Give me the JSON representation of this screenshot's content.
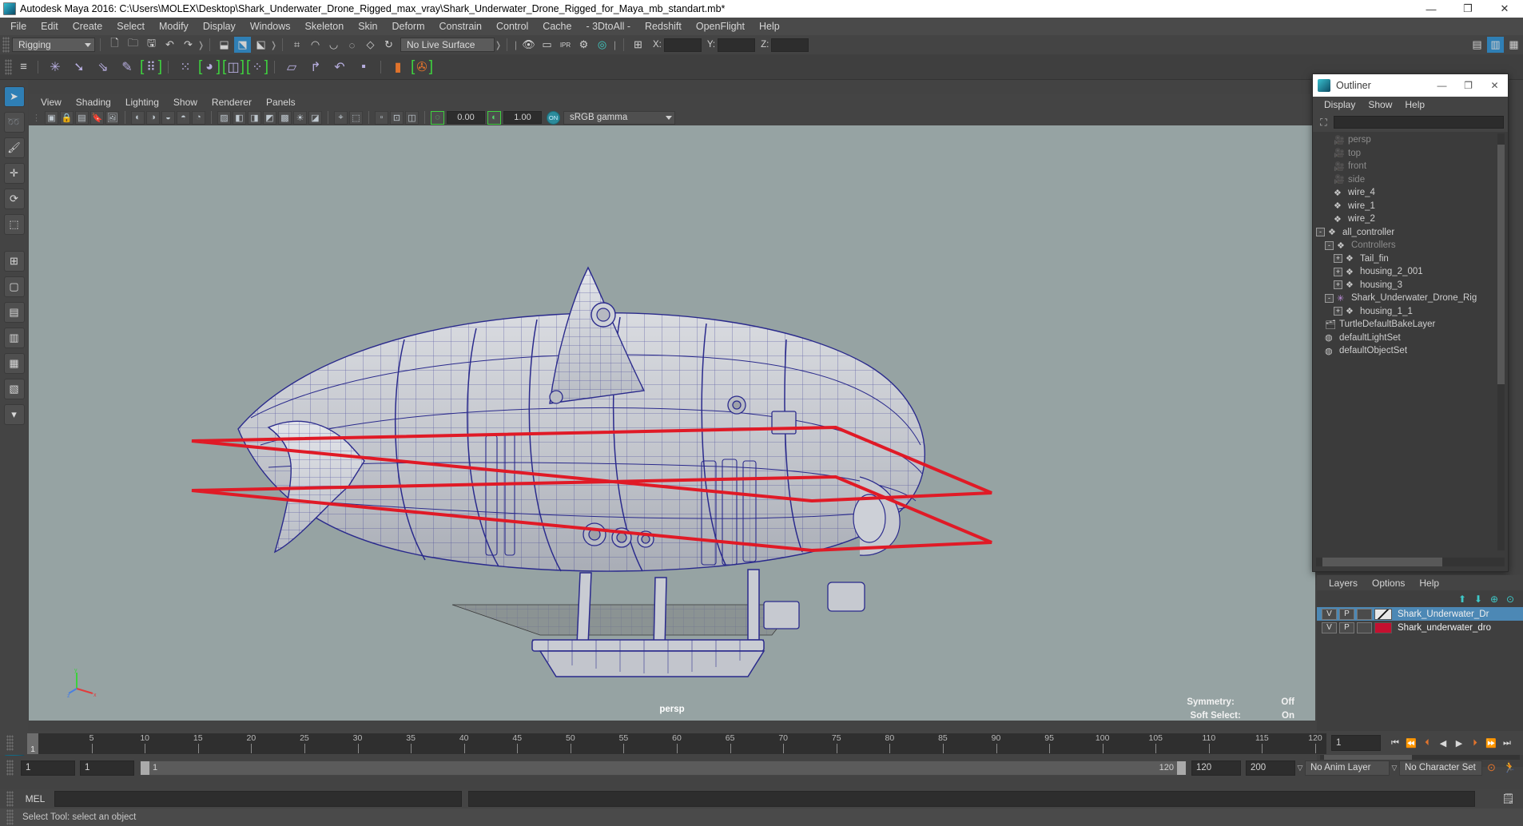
{
  "window": {
    "title": "Autodesk Maya 2016: C:\\Users\\MOLEX\\Desktop\\Shark_Underwater_Drone_Rigged_max_vray\\Shark_Underwater_Drone_Rigged_for_Maya_mb_standart.mb*",
    "minimize": "—",
    "maximize": "❐",
    "close": "✕"
  },
  "menubar": {
    "items": [
      "File",
      "Edit",
      "Create",
      "Select",
      "Modify",
      "Display",
      "Windows",
      "Skeleton",
      "Skin",
      "Deform",
      "Constrain",
      "Control",
      "Cache",
      "- 3DtoAll -",
      "Redshift",
      "OpenFlight",
      "Help"
    ]
  },
  "statusline": {
    "mode": "Rigging",
    "live_surface": "No Live Surface",
    "x_label": "X:",
    "y_label": "Y:",
    "z_label": "Z:",
    "x_value": "",
    "y_value": "",
    "z_value": "",
    "ipr_label": "IPR"
  },
  "viewport_menu": {
    "items": [
      "View",
      "Shading",
      "Lighting",
      "Show",
      "Renderer",
      "Panels"
    ]
  },
  "viewport_toolbar": {
    "exposure": "0.00",
    "gamma": "1.00",
    "color_toggle": "ON",
    "color_profile": "sRGB gamma"
  },
  "viewport": {
    "camera_label": "persp",
    "symmetry_label": "Symmetry:",
    "symmetry_value": "Off",
    "soft_select_label": "Soft Select:",
    "soft_select_value": "On",
    "axis_x": "x",
    "axis_y": "y",
    "axis_z": "z",
    "background_color": "#96a3a3",
    "wireframe_color": "#2a2a8c",
    "selection_color": "#e01a26"
  },
  "outliner": {
    "title": "Outliner",
    "minimize": "—",
    "maximize": "❐",
    "close": "✕",
    "menu": [
      "Display",
      "Show",
      "Help"
    ],
    "search_value": "",
    "items": [
      {
        "label": "persp",
        "indent": 1,
        "icon": "camera-icon",
        "dim": true,
        "toggle": ""
      },
      {
        "label": "top",
        "indent": 1,
        "icon": "camera-icon",
        "dim": true,
        "toggle": ""
      },
      {
        "label": "front",
        "indent": 1,
        "icon": "camera-icon",
        "dim": true,
        "toggle": ""
      },
      {
        "label": "side",
        "indent": 1,
        "icon": "camera-icon",
        "dim": true,
        "toggle": ""
      },
      {
        "label": "wire_4",
        "indent": 1,
        "icon": "mesh-icon",
        "dim": false,
        "toggle": ""
      },
      {
        "label": "wire_1",
        "indent": 1,
        "icon": "mesh-icon",
        "dim": false,
        "toggle": ""
      },
      {
        "label": "wire_2",
        "indent": 1,
        "icon": "mesh-icon",
        "dim": false,
        "toggle": ""
      },
      {
        "label": "all_controller",
        "indent": 0,
        "icon": "mesh-icon",
        "dim": false,
        "toggle": "-"
      },
      {
        "label": "Controllers",
        "indent": 1,
        "icon": "mesh-icon",
        "dim": true,
        "toggle": "-"
      },
      {
        "label": "Tail_fin",
        "indent": 2,
        "icon": "mesh-icon",
        "dim": false,
        "toggle": "+"
      },
      {
        "label": "housing_2_001",
        "indent": 2,
        "icon": "mesh-icon",
        "dim": false,
        "toggle": "+"
      },
      {
        "label": "housing_3",
        "indent": 2,
        "icon": "mesh-icon",
        "dim": false,
        "toggle": "+"
      },
      {
        "label": "Shark_Underwater_Drone_Rig",
        "indent": 1,
        "icon": "star-icon",
        "dim": false,
        "toggle": "-"
      },
      {
        "label": "housing_1_1",
        "indent": 2,
        "icon": "mesh-icon",
        "dim": false,
        "toggle": "+"
      },
      {
        "label": "TurtleDefaultBakeLayer",
        "indent": 0,
        "icon": "layer-icon",
        "dim": false,
        "toggle": ""
      },
      {
        "label": "defaultLightSet",
        "indent": 0,
        "icon": "set-icon",
        "dim": false,
        "toggle": ""
      },
      {
        "label": "defaultObjectSet",
        "indent": 0,
        "icon": "set-icon",
        "dim": false,
        "toggle": ""
      }
    ]
  },
  "layer_editor": {
    "menu": [
      "Layers",
      "Options",
      "Help"
    ],
    "rows": [
      {
        "v": "V",
        "p": "P",
        "third": "",
        "swatch": "#bdbdbd",
        "name": "Shark_Underwater_Dr",
        "selected": true
      },
      {
        "v": "V",
        "p": "P",
        "third": "",
        "swatch": "#c41030",
        "name": "Shark_underwater_dro",
        "selected": false
      }
    ]
  },
  "timeline": {
    "ticks": [
      5,
      10,
      15,
      20,
      25,
      30,
      35,
      40,
      45,
      50,
      55,
      60,
      65,
      70,
      75,
      80,
      85,
      90,
      95,
      100,
      105,
      110,
      115,
      120
    ],
    "start_frame": "1",
    "current_frame": "1",
    "max_frame": "120"
  },
  "range_slider": {
    "anim_start": "1",
    "range_start": "1",
    "bar_left_value": "1",
    "bar_right_value": "120",
    "range_end": "120",
    "anim_end": "200",
    "anim_layer": "No Anim Layer",
    "character_set": "No Character Set"
  },
  "command_line": {
    "label": "MEL",
    "value": "",
    "placeholder": ""
  },
  "status_bar": {
    "message": "Select Tool: select an object"
  }
}
